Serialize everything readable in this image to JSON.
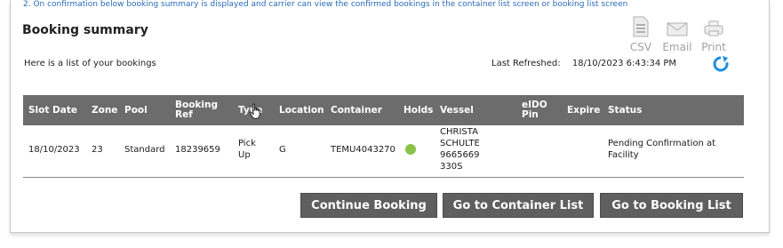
{
  "instruction": "2. On confirmation below booking summary is displayed and carrier can view the confirmed bookings in the container list screen or booking list screen",
  "title": "Booking summary",
  "subtitle": "Here is a list of your bookings",
  "last_refreshed": {
    "label": "Last Refreshed:",
    "value": "18/10/2023 6:43:34 PM"
  },
  "tools": {
    "csv": "CSV",
    "email": "Email",
    "print": "Print"
  },
  "colors": {
    "header_bg": "#6c6c6c",
    "button_bg": "#5f5f5f",
    "link_blue": "#2a6bb8",
    "hold_green": "#8bc34a",
    "refresh_blue": "#1f8fe0"
  },
  "columns": [
    "Slot Date",
    "Zone",
    "Pool",
    "Booking Ref",
    "Type",
    "Location",
    "Container",
    "Holds",
    "Vessel",
    "eIDO Pin",
    "Expire",
    "Status"
  ],
  "row": {
    "slot_date": "18/10/2023",
    "zone": "23",
    "pool": "Standard",
    "booking_ref": "18239659",
    "type": "Pick Up",
    "location": "G",
    "container": "TEMU4043270",
    "vessel": "CHRISTA SCHULTE 9665669 330S",
    "eido_pin": "",
    "expire": "",
    "status": "Pending Confirmation at Facility"
  },
  "buttons": {
    "continue": "Continue Booking",
    "container_list": "Go to Container List",
    "booking_list": "Go to Booking List"
  }
}
